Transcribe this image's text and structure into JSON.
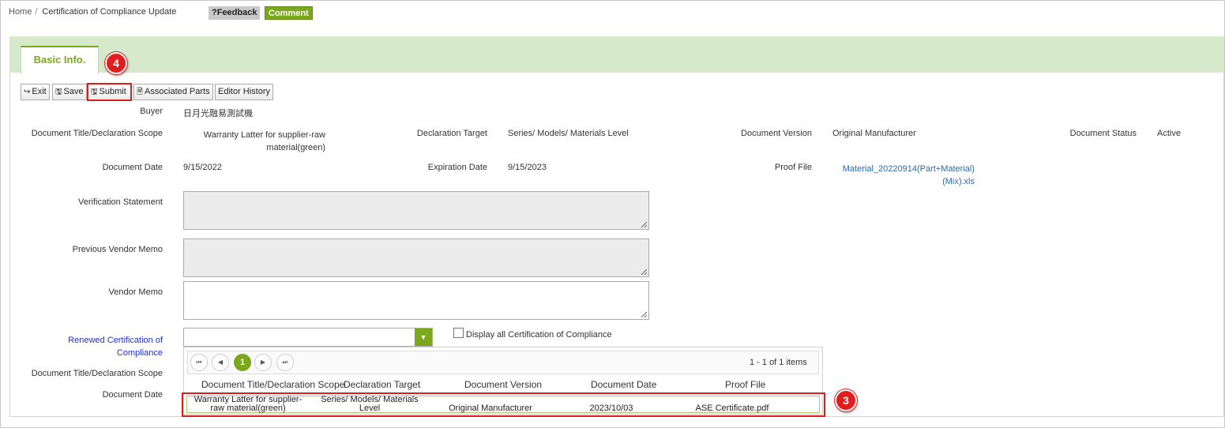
{
  "breadcrumb": {
    "home": "Home",
    "current": "Certification of Compliance Update"
  },
  "header": {
    "feedback_label": "?Feedback",
    "comment_label": "Comment"
  },
  "tabs": [
    {
      "label": "Basic Info."
    }
  ],
  "toolbar": {
    "exit_label": "Exit",
    "save_label": "Save",
    "submit_label": "Submit",
    "associated_parts_label": "Associated Parts",
    "editor_history_label": "Editor History"
  },
  "badges": {
    "step_submit": "4",
    "step_row": "3"
  },
  "form": {
    "buyer": {
      "label": "Buyer",
      "value": "日月光融易測試機"
    },
    "doc_title": {
      "label": "Document Title/Declaration Scope",
      "value_line1": "Warranty Latter for supplier-raw",
      "value_line2": "material(green)"
    },
    "decl_target": {
      "label": "Declaration Target",
      "value": "Series/ Models/ Materials Level"
    },
    "doc_version": {
      "label": "Document Version",
      "value": "Original Manufacturer"
    },
    "doc_status": {
      "label": "Document Status",
      "value": "Active"
    },
    "doc_date": {
      "label": "Document Date",
      "value": "9/15/2022"
    },
    "exp_date": {
      "label": "Expiration Date",
      "value": "9/15/2023"
    },
    "proof_file": {
      "label": "Proof File",
      "value_line1": "Material_20220914(Part+Material)",
      "value_line2": "(Mix).xls"
    },
    "verification": {
      "label": "Verification Statement",
      "value": ""
    },
    "prev_memo": {
      "label": "Previous Vendor Memo",
      "value": ""
    },
    "vendor_memo": {
      "label": "Vendor Memo",
      "value": ""
    },
    "renewed": {
      "label_line1": "Renewed Certification of",
      "label_line2": "Compliance",
      "value": ""
    },
    "display_all_label": "Display all Certification of Compliance",
    "doc_title2_label": "Document Title/Declaration Scope",
    "doc_date2_label": "Document Date"
  },
  "grid": {
    "page": "1",
    "summary": "1 - 1 of 1 items",
    "columns": [
      "Document Title/Declaration Scope",
      "Declaration Target",
      "Document Version",
      "Document Date",
      "Proof File"
    ],
    "rows": [
      {
        "title_line1": "Warranty Latter for supplier-",
        "title_line2": "raw material(green)",
        "target_line1": "Series/ Models/ Materials",
        "target_line2": "Level",
        "version": "Original Manufacturer",
        "date": "2023/10/03",
        "proof": "ASE Certificate.pdf"
      }
    ]
  },
  "colors": {
    "accent_green": "#7aa71b",
    "tabbar_bg": "#d6e9cb",
    "highlight_red": "#e01b1b"
  }
}
